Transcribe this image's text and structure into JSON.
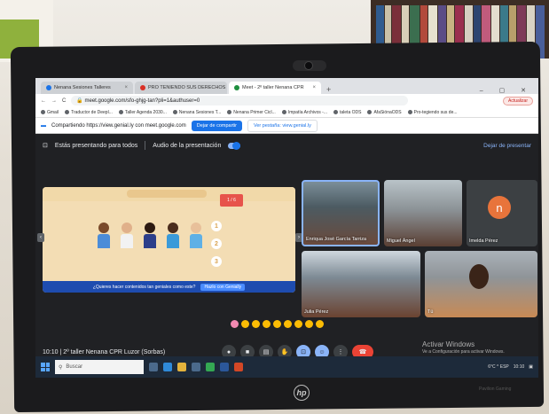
{
  "browser": {
    "tabs": [
      {
        "label": "Nenana Sesiones Talleres",
        "close": "×"
      },
      {
        "label": "PRO TENIENDO SUS DERECHOS",
        "close": "×"
      },
      {
        "label": "Meet - 2º taller Nenana CPR",
        "close": "×"
      }
    ],
    "new_tab": "+",
    "window_controls": "– ▢ ✕",
    "url": "meet.google.com/sfo-ghjg-tan?pli=1&authuser=0",
    "update_label": "Actualizar",
    "bookmarks": [
      "Gmail",
      "Traductor de Deepl...",
      "Taller Agenda 2030...",
      "Nenana Sesiones T...",
      "Nenana Primer Cicl...",
      "Impatía Archivos -...",
      "taleta ODS",
      "AfaSiónaODS",
      "Pro-tegiendo sus de..."
    ]
  },
  "sharebar": {
    "text": "Compartiendo https://view.genial.ly con meet.google.com",
    "stop_label": "Dejar de compartir",
    "go_label": "Ver pestaña: view.genial.ly"
  },
  "meet": {
    "presenting_text": "Estás presentando para todos",
    "audio_label": "Audio de la presentación",
    "stop_presenting": "Dejar de presentar",
    "slide": {
      "badge": "1 / 6",
      "numbers": [
        "1",
        "2",
        "3"
      ],
      "footer_text": "¿Quieres hacer contenidos tan geniales como este?",
      "footer_button": "Hazlo con Genially"
    },
    "participants": [
      {
        "name": "Enriqua José García Tarriza"
      },
      {
        "name": "Miguel Ángel"
      },
      {
        "name": "Imelda Pérez",
        "initial": "n"
      },
      {
        "name": "Julia Pérez"
      },
      {
        "name": "Tú"
      }
    ],
    "meeting_info": "10:10  |  2º taller Nenana CPR Luzor (Sorbas)",
    "watermark_title": "Activar Windows",
    "watermark_sub": "Ve a Configuración para activar Windows."
  },
  "taskbar": {
    "search_placeholder": "Buscar",
    "tray_text": "6°C  ^  ESP",
    "clock": "10:10"
  },
  "device": {
    "brand": "hp",
    "model": "Pavilion Gaming"
  },
  "colors": {
    "meet_bg": "#202124",
    "accent_blue": "#1a73e8",
    "end_call_red": "#ea4335",
    "avatar_orange": "#e8743b"
  }
}
